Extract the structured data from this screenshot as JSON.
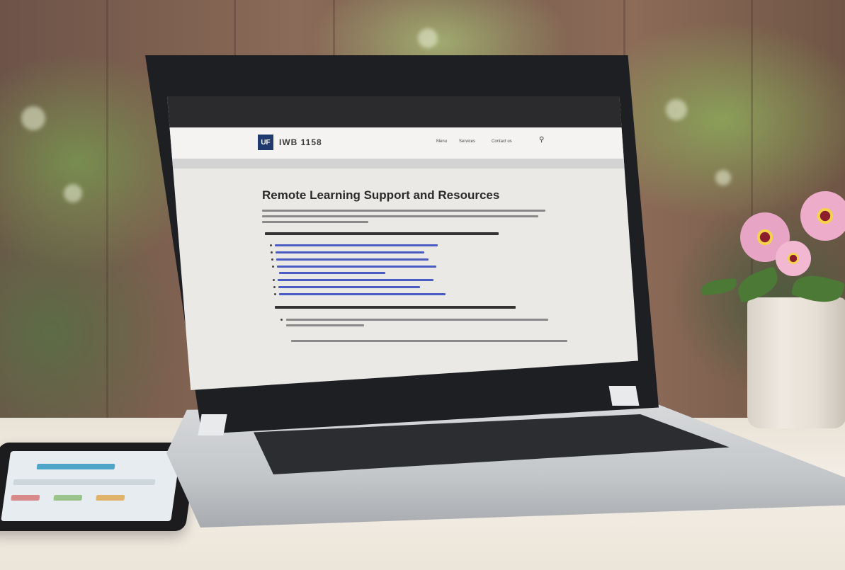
{
  "scene": {
    "description_type": "photo",
    "laptop_screen": {
      "site_name": "IWB 1158",
      "logo_text": "UF",
      "page_title": "Remote Learning Support and Resources",
      "nav_items": [
        "Menu",
        "Services",
        "Contact us"
      ],
      "search_icon": "magnifier-icon"
    },
    "colors": {
      "laptop_bezel": "#1e1f23",
      "site_logo": "#213a6d",
      "link_text": "#4a5bc4",
      "table_top": "#ece5d9"
    }
  }
}
